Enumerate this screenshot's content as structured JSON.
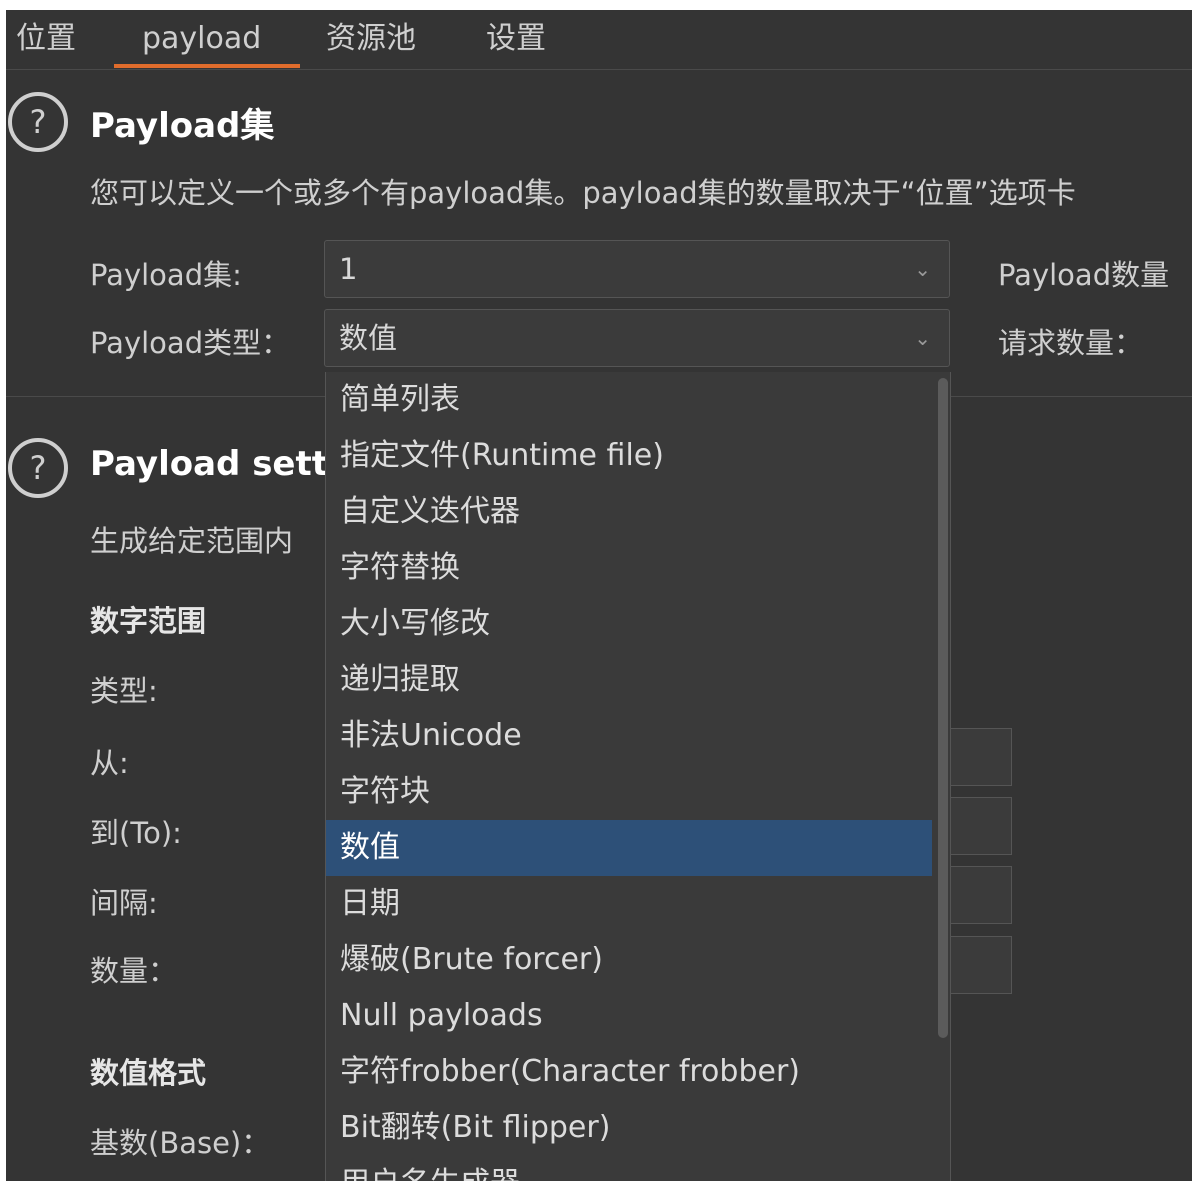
{
  "tabs": [
    "位置",
    "payload",
    "资源池",
    "设置"
  ],
  "payload_sets": {
    "title": "Payload集",
    "description": "您可以定义一个或多个有payload集。payload集的数量取决于“位置”选项卡",
    "set_label": "Payload集:",
    "set_value": "1",
    "type_label": "Payload类型：",
    "type_value": "数值",
    "count_label": "Payload数量",
    "request_label": "请求数量："
  },
  "payload_settings": {
    "title": "Payload sett",
    "description": "生成给定范围内",
    "number_range": "数字范围",
    "type_label": "类型:",
    "from_label": "从:",
    "to_label": "到(To):",
    "step_label": "间隔:",
    "count_label": "数量：",
    "number_format": "数值格式",
    "base_label": "基数(Base)："
  },
  "dropdown": {
    "items": [
      "简单列表",
      "指定文件(Runtime file)",
      "自定义迭代器",
      "字符替换",
      "大小写修改",
      "递归提取",
      "非法Unicode",
      "字符块",
      "数值",
      "日期",
      "爆破(Brute forcer)",
      "Null payloads",
      "字符frobber(Character frobber)",
      "Bit翻转(Bit flipper)",
      "用户名生成器"
    ],
    "selected_index": 8
  },
  "colors": {
    "background": "#343434",
    "accent": "#e06c2c",
    "selected": "#2d5078"
  }
}
